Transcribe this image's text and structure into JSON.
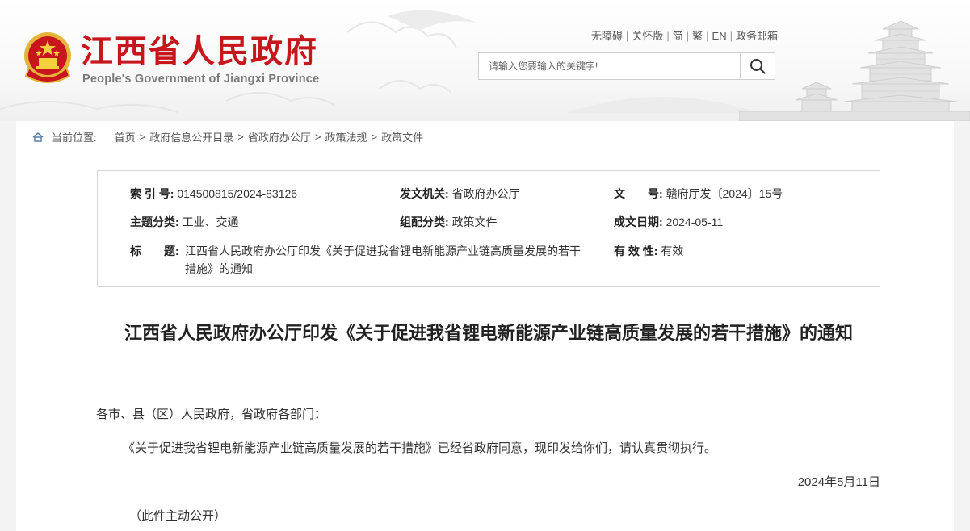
{
  "header": {
    "title": "江西省人民政府",
    "subtitle": "People's Government of Jiangxi Province",
    "top_links": [
      "无障碍",
      "关怀版",
      "简",
      "繁",
      "EN",
      "政务邮箱"
    ],
    "search": {
      "placeholder": "请输入您要输入的关键字!"
    },
    "icons": {
      "search": "search-icon",
      "emblem": "national-emblem-icon"
    },
    "brand_color": "#c8161d"
  },
  "breadcrumb": {
    "label": "当前位置:",
    "items": [
      "首页",
      "政府信息公开目录",
      "省政府办公厅",
      "政策法规",
      "政策文件"
    ]
  },
  "info": {
    "index_label": "索 引 号:",
    "index_value": "014500815/2024-83126",
    "issuer_label": "发文机关:",
    "issuer_value": "省政府办公厅",
    "docno_label": "文　　号:",
    "docno_value": "赣府厅发〔2024〕15号",
    "topic_label": "主题分类:",
    "topic_value": "工业、交通",
    "category_label": "组配分类:",
    "category_value": "政策文件",
    "date_label": "成文日期:",
    "date_value": "2024-05-11",
    "title_label": "标　　题:",
    "title_value": "江西省人民政府办公厅印发《关于促进我省锂电新能源产业链高质量发展的若干措施》的通知",
    "validity_label": "有 效 性:",
    "validity_value": "有效"
  },
  "article": {
    "title": "江西省人民政府办公厅印发《关于促进我省锂电新能源产业链高质量发展的若干措施》的通知",
    "salutation": "各市、县（区）人民政府，省政府各部门：",
    "paragraph": "《关于促进我省锂电新能源产业链高质量发展的若干措施》已经省政府同意，现印发给你们，请认真贯彻执行。",
    "date": "2024年5月11日",
    "public_note": "（此件主动公开）"
  }
}
